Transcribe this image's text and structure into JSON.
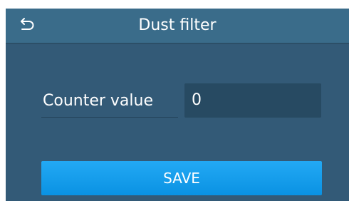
{
  "header": {
    "title": "Dust filter",
    "back_icon": "back-arrow-icon"
  },
  "form": {
    "counter_label": "Counter value",
    "counter_value": "0"
  },
  "actions": {
    "save_label": "SAVE"
  },
  "colors": {
    "background": "#335a77",
    "header": "#3a6c8a",
    "input": "#274a62",
    "accent": "#0a92e3"
  }
}
